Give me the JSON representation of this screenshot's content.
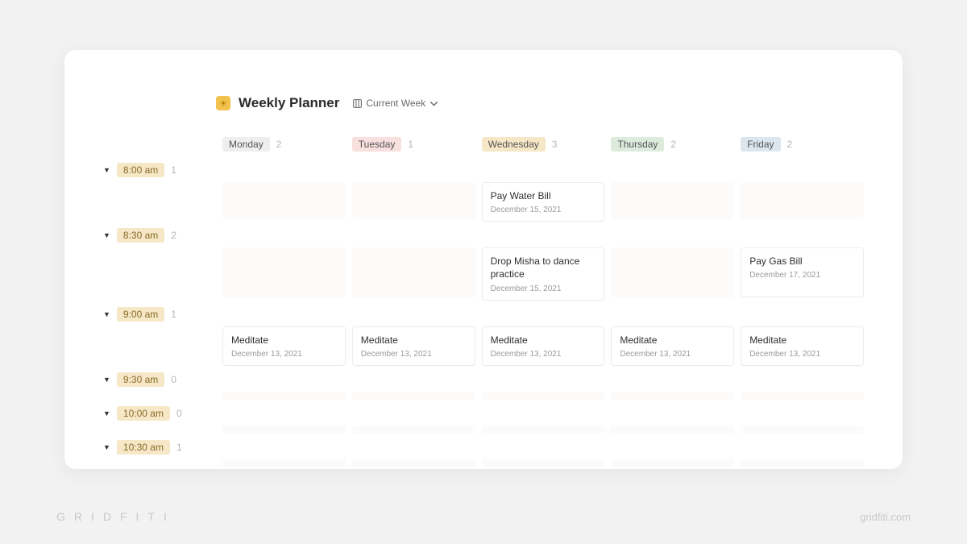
{
  "brand": {
    "left": "GRIDFITI",
    "right": "gridfiti.com"
  },
  "header": {
    "title": "Weekly Planner",
    "view_label": "Current Week"
  },
  "days": [
    {
      "label": "Monday",
      "count": "2",
      "pill": "pill-grey"
    },
    {
      "label": "Tuesday",
      "count": "1",
      "pill": "pill-pink"
    },
    {
      "label": "Wednesday",
      "count": "3",
      "pill": "pill-yellow"
    },
    {
      "label": "Thursday",
      "count": "2",
      "pill": "pill-green"
    },
    {
      "label": "Friday",
      "count": "2",
      "pill": "pill-blue"
    }
  ],
  "slots": [
    {
      "time": "8:00 am",
      "count": "1",
      "cells": [
        null,
        null,
        {
          "title": "Pay Water Bill",
          "date": "December 15, 2021"
        },
        null,
        null
      ]
    },
    {
      "time": "8:30 am",
      "count": "2",
      "cells": [
        null,
        null,
        {
          "title": "Drop Misha to dance practice",
          "date": "December 15, 2021"
        },
        null,
        {
          "title": "Pay Gas Bill",
          "date": "December 17, 2021"
        }
      ]
    },
    {
      "time": "9:00 am",
      "count": "1",
      "cells": [
        {
          "title": "Meditate",
          "date": "December 13, 2021"
        },
        {
          "title": "Meditate",
          "date": "December 13, 2021"
        },
        {
          "title": "Meditate",
          "date": "December 13, 2021"
        },
        {
          "title": "Meditate",
          "date": "December 13, 2021"
        },
        {
          "title": "Meditate",
          "date": "December 13, 2021"
        }
      ]
    },
    {
      "time": "9:30 am",
      "count": "0",
      "cells": [
        "sm",
        "sm",
        "sm",
        "sm",
        "sm"
      ]
    },
    {
      "time": "10:00 am",
      "count": "0",
      "cells": [
        "sm",
        "sm",
        "sm",
        "sm",
        "sm"
      ]
    },
    {
      "time": "10:30 am",
      "count": "1",
      "cells": [
        "sm",
        "sm",
        "sm",
        "sm",
        "sm"
      ]
    }
  ]
}
